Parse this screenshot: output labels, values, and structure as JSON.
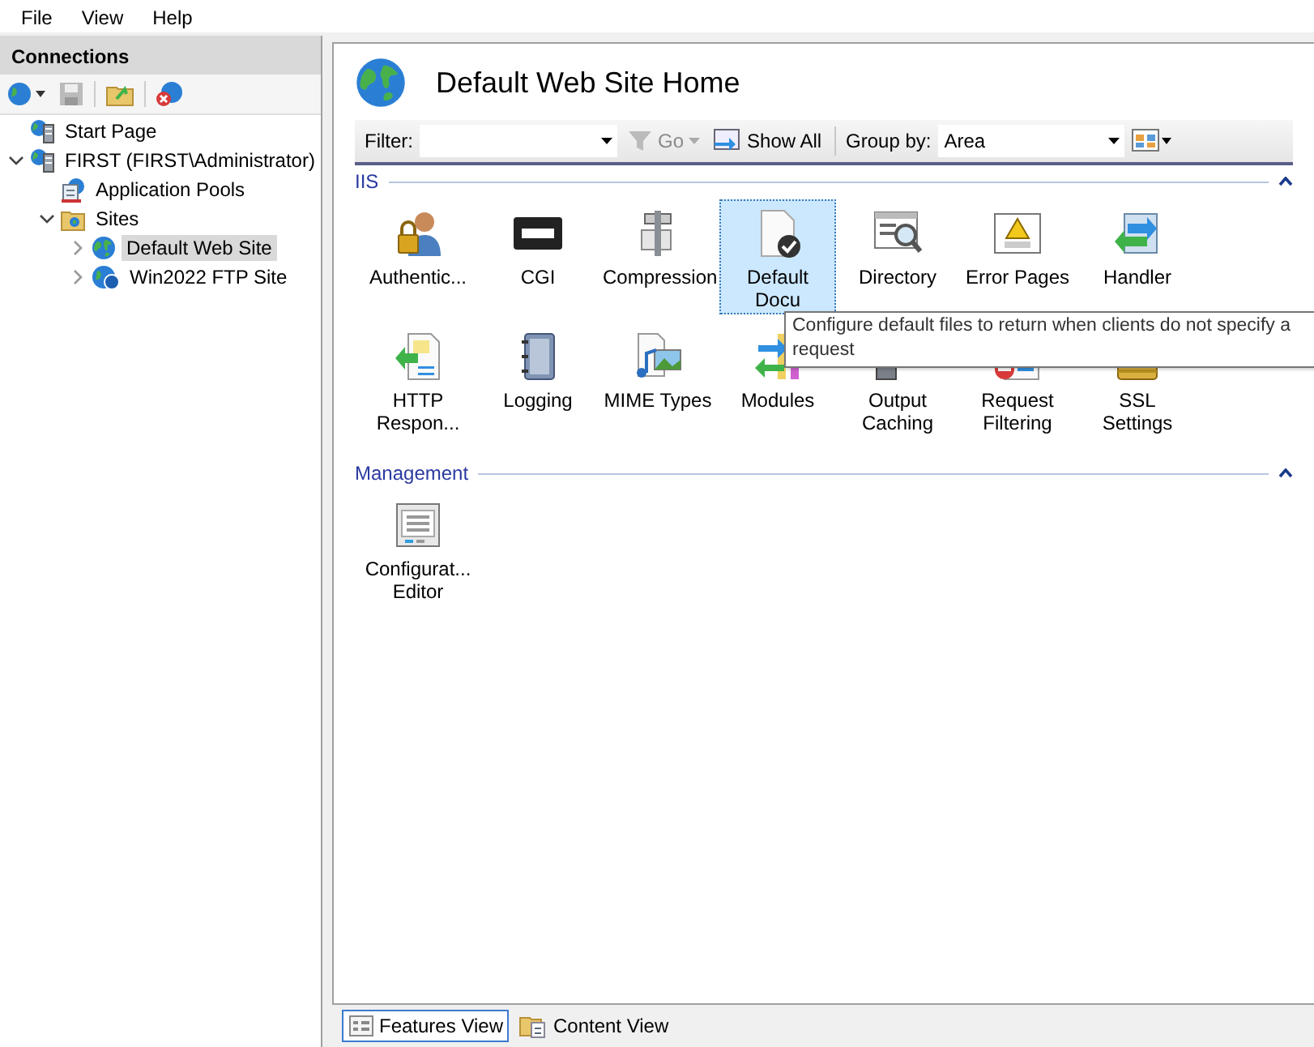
{
  "menu": [
    "File",
    "View",
    "Help"
  ],
  "connections": {
    "title": "Connections",
    "tree": [
      {
        "label": "Start Page",
        "selected": false
      },
      {
        "label": "FIRST (FIRST\\Administrator)",
        "selected": false,
        "expanded": true,
        "children": [
          {
            "label": "Application Pools",
            "selected": false
          },
          {
            "label": "Sites",
            "selected": false,
            "expanded": true,
            "children": [
              {
                "label": "Default Web Site",
                "selected": true,
                "expanded": false
              },
              {
                "label": "Win2022 FTP Site",
                "selected": false,
                "expanded": false
              }
            ]
          }
        ]
      }
    ]
  },
  "home": {
    "title": "Default Web Site Home",
    "toolbar": {
      "filter_label": "Filter:",
      "go": {
        "label": "Go",
        "disabled": true
      },
      "show_all": "Show All",
      "group_by_label": "Group by:",
      "group_by_value": "Area"
    },
    "groups": [
      {
        "title": "IIS",
        "expanded": true,
        "tiles": [
          {
            "label": "Authentic...",
            "selected": false
          },
          {
            "label": "CGI",
            "selected": false
          },
          {
            "label": "Compression",
            "selected": false
          },
          {
            "label": "Default Docu",
            "selected": true
          },
          {
            "label": "Directory",
            "selected": false
          },
          {
            "label": "Error Pages",
            "selected": false
          },
          {
            "label": "Handler",
            "selected": false
          },
          {
            "label": "HTTP Respon...",
            "selected": false
          },
          {
            "label": "Logging",
            "selected": false
          },
          {
            "label": "MIME Types",
            "selected": false
          },
          {
            "label": "Modules",
            "selected": false
          },
          {
            "label": "Output Caching",
            "selected": false
          },
          {
            "label": "Request Filtering",
            "selected": false
          },
          {
            "label": "SSL Settings",
            "selected": false
          }
        ]
      },
      {
        "title": "Management",
        "expanded": true,
        "tiles": [
          {
            "label": "Configurat... Editor",
            "selected": false
          }
        ]
      }
    ],
    "tooltip": "Configure default files to return when clients do not specify a request"
  },
  "view_tabs": [
    {
      "label": "Features View",
      "selected": true
    },
    {
      "label": "Content View",
      "selected": false
    }
  ]
}
